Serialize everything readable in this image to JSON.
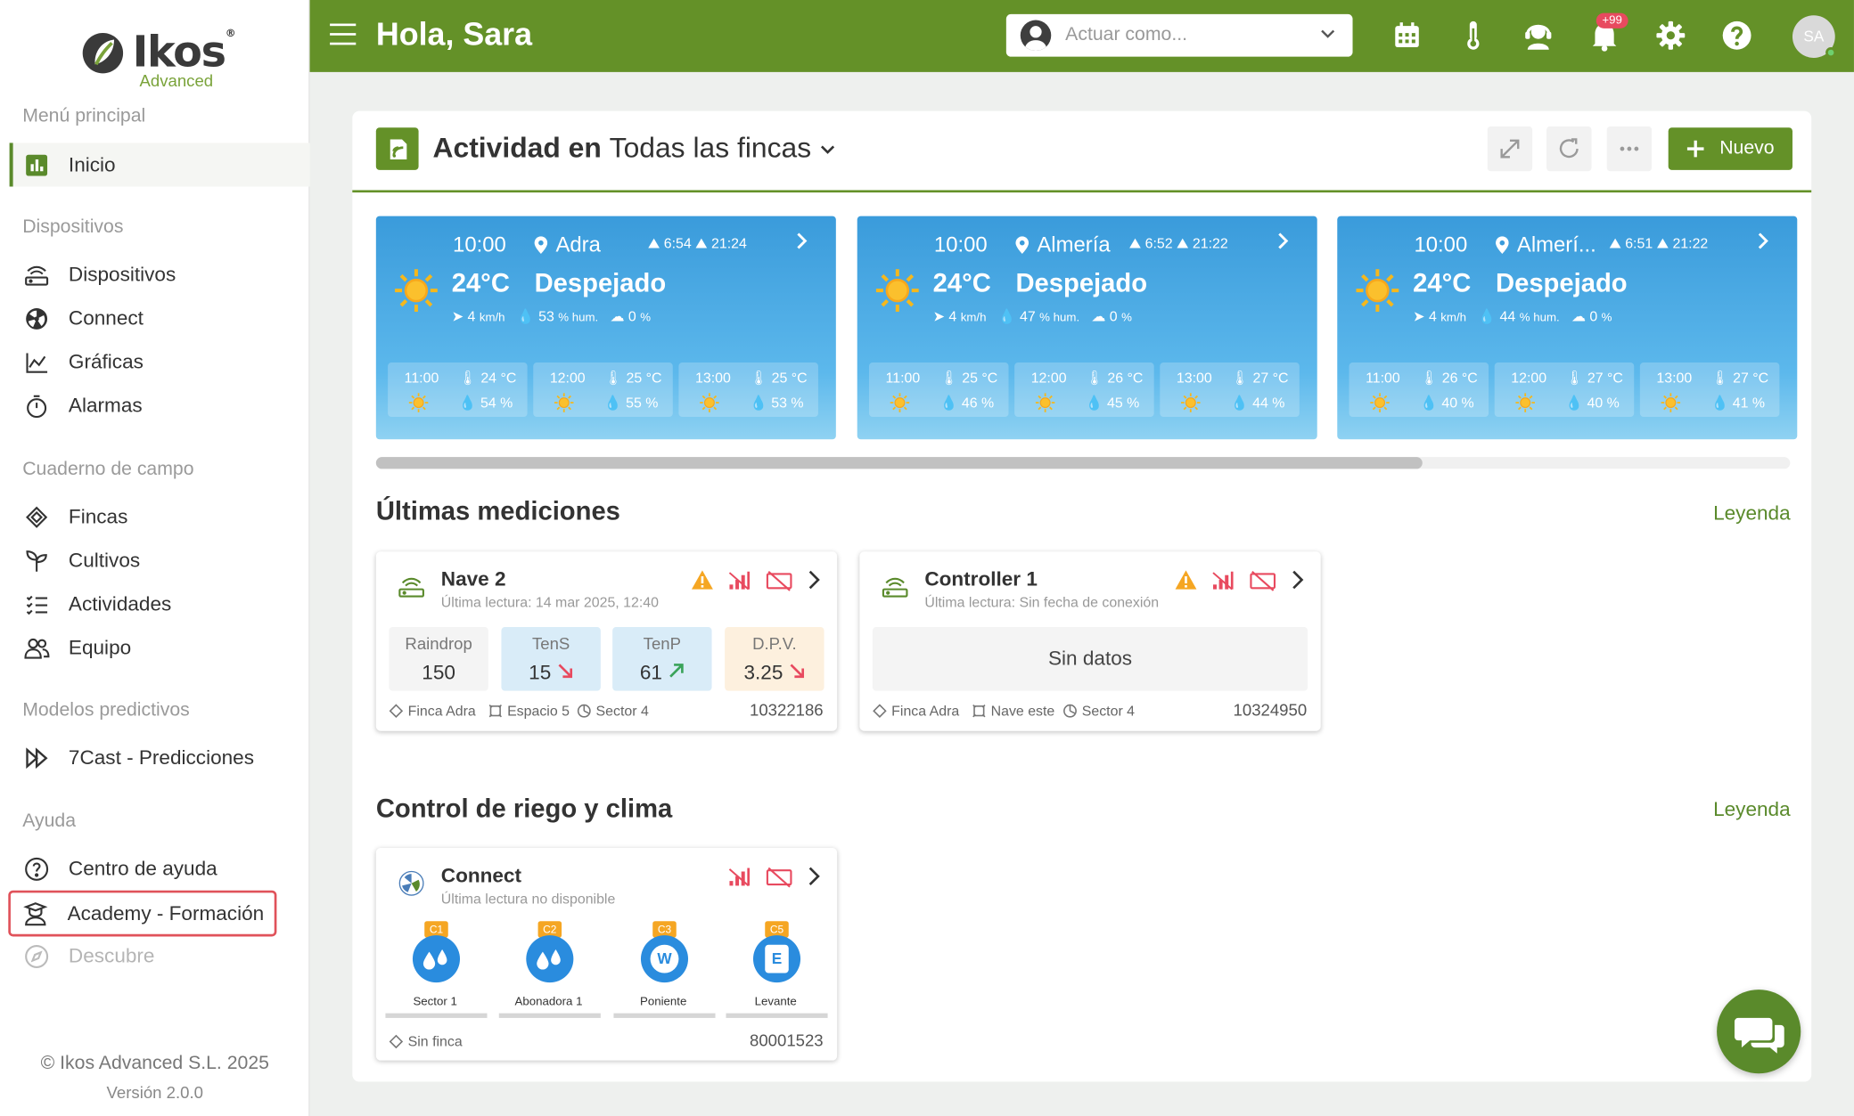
{
  "sidebar": {
    "brand": "Ikos",
    "brand_sub": "Advanced",
    "main_section": "Menú principal",
    "inicio": "Inicio",
    "sec_dispositivos": "Dispositivos",
    "dispositivos": "Dispositivos",
    "connect": "Connect",
    "graficas": "Gráficas",
    "alarmas": "Alarmas",
    "sec_cuaderno": "Cuaderno de campo",
    "fincas": "Fincas",
    "cultivos": "Cultivos",
    "actividades": "Actividades",
    "equipo": "Equipo",
    "sec_modelos": "Modelos predictivos",
    "predicciones": "7Cast - Predicciones",
    "sec_ayuda": "Ayuda",
    "centro": "Centro de ayuda",
    "academy": "Academy - Formación",
    "descubre": "Descubre",
    "copyright": "© Ikos Advanced S.L. 2025",
    "version": "Versión 2.0.0"
  },
  "topbar": {
    "greeting": "Hola, Sara",
    "act_as_placeholder": "Actuar como...",
    "notif_badge": "+99",
    "avatar": "SA"
  },
  "panel": {
    "title_bold": "Actividad en",
    "title_farm": "Todas las fincas",
    "nuevo": "Nuevo"
  },
  "weather": [
    {
      "time": "10:00",
      "loc": "Adra",
      "sunrise": "6:54",
      "sunset": "21:24",
      "temp": "24°C",
      "cond": "Despejado",
      "wind": "4",
      "hum": "53",
      "cloud": "0",
      "hours": [
        {
          "h": "11:00",
          "t": "24 °C",
          "hum": "54 %"
        },
        {
          "h": "12:00",
          "t": "25 °C",
          "hum": "55 %"
        },
        {
          "h": "13:00",
          "t": "25 °C",
          "hum": "53 %"
        }
      ]
    },
    {
      "time": "10:00",
      "loc": "Almería",
      "sunrise": "6:52",
      "sunset": "21:22",
      "temp": "24°C",
      "cond": "Despejado",
      "wind": "4",
      "hum": "47",
      "cloud": "0",
      "hours": [
        {
          "h": "11:00",
          "t": "25 °C",
          "hum": "46 %"
        },
        {
          "h": "12:00",
          "t": "26 °C",
          "hum": "45 %"
        },
        {
          "h": "13:00",
          "t": "27 °C",
          "hum": "44 %"
        }
      ]
    },
    {
      "time": "10:00",
      "loc": "Almerí...",
      "sunrise": "6:51",
      "sunset": "21:22",
      "temp": "24°C",
      "cond": "Despejado",
      "wind": "4",
      "hum": "44",
      "cloud": "0",
      "hours": [
        {
          "h": "11:00",
          "t": "26 °C",
          "hum": "40 %"
        },
        {
          "h": "12:00",
          "t": "27 °C",
          "hum": "40 %"
        },
        {
          "h": "13:00",
          "t": "27 °C",
          "hum": "41 %"
        }
      ]
    }
  ],
  "weather_units": {
    "wind": "km/h",
    "hum": "% hum.",
    "cloud": "%"
  },
  "scroll_visible_fraction": 0.74,
  "mediciones": {
    "title": "Últimas mediciones",
    "legend": "Leyenda",
    "nave": {
      "name": "Nave 2",
      "sub": "Última lectura: 14 mar 2025, 12:40",
      "tiles": [
        {
          "label": "Raindrop",
          "value": "150"
        },
        {
          "label": "TenS",
          "value": "15"
        },
        {
          "label": "TenP",
          "value": "61"
        },
        {
          "label": "D.P.V.",
          "value": "3.25"
        }
      ],
      "finca": "Finca Adra",
      "espacio": "Espacio 5",
      "sector": "Sector 4",
      "serial": "10322186"
    },
    "controller": {
      "name": "Controller 1",
      "sub": "Última lectura: Sin fecha de conexión",
      "empty": "Sin datos",
      "finca": "Finca Adra",
      "espacio": "Nave este",
      "sector": "Sector 4",
      "serial": "10324950"
    }
  },
  "riego": {
    "title": "Control de riego y clima",
    "legend": "Leyenda",
    "connect": {
      "name": "Connect",
      "sub": "Última lectura no disponible",
      "valves": [
        {
          "tag": "C1",
          "name": "Sector 1"
        },
        {
          "tag": "C2",
          "name": "Abonadora 1"
        },
        {
          "tag": "C3",
          "name": "Poniente"
        },
        {
          "tag": "C5",
          "name": "Levante"
        }
      ],
      "valve_letters": {
        "c3": "W",
        "c5": "E"
      },
      "finca": "Sin finca",
      "serial": "80001523"
    }
  },
  "colors": {
    "brand": "#649128",
    "warning": "#f5a623",
    "alert": "#e84a5f",
    "sky": "#3a9bdb"
  }
}
